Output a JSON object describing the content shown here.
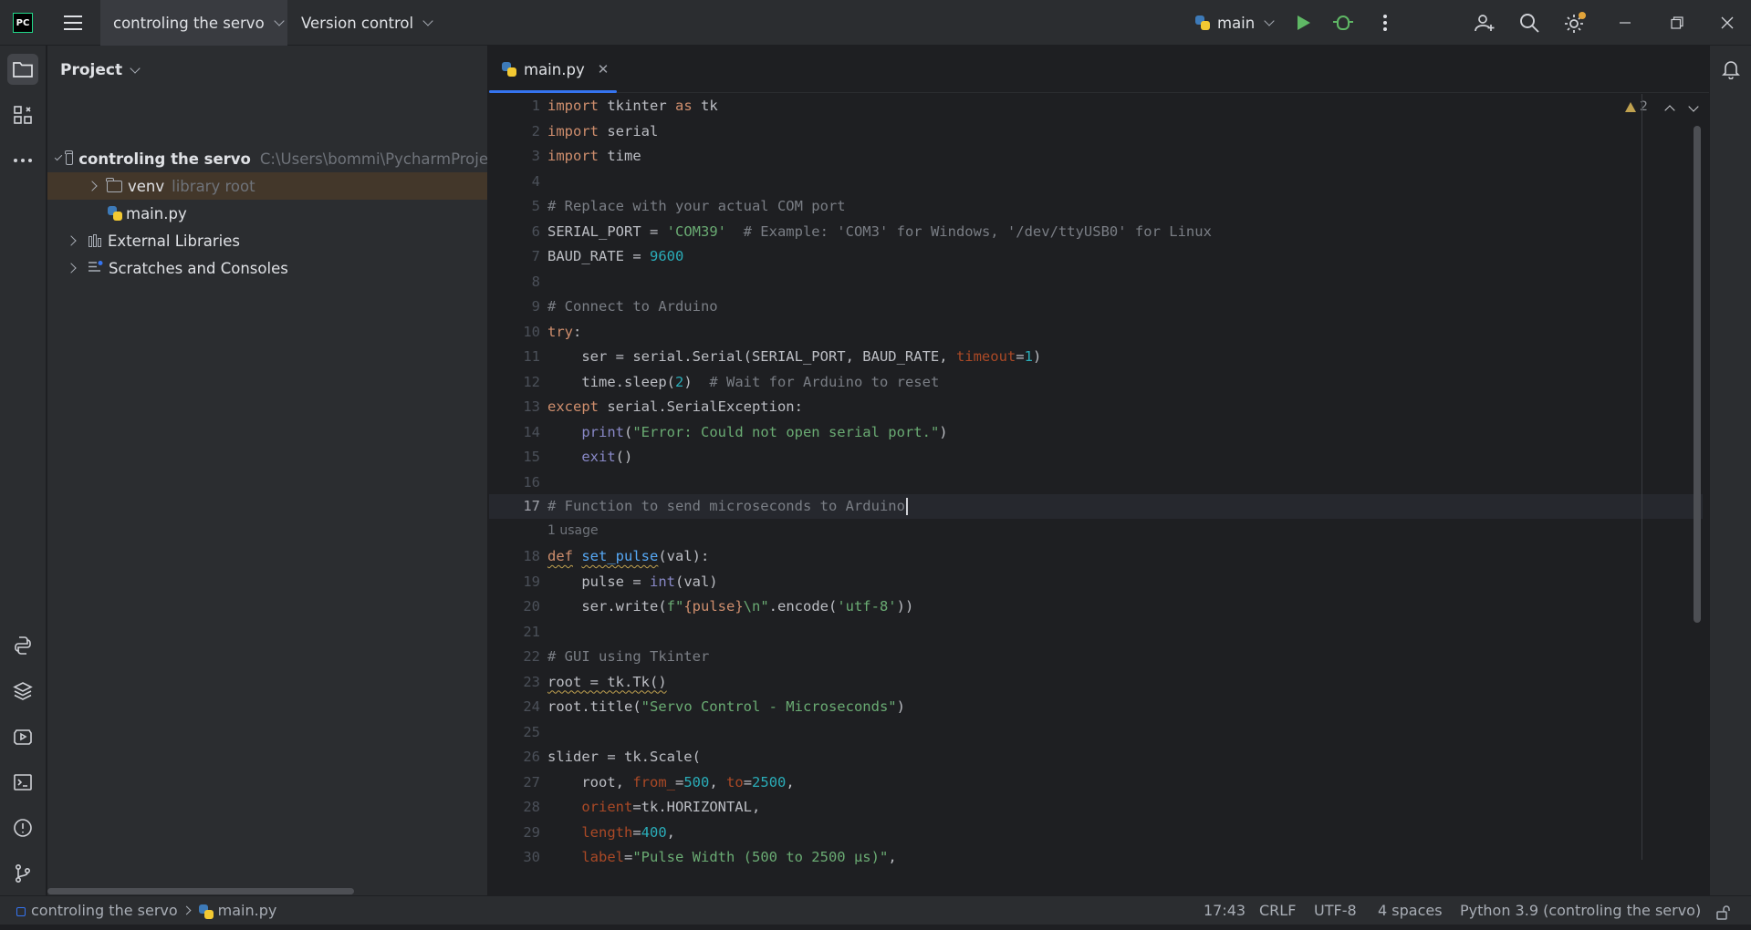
{
  "titlebar": {
    "logo_text": "PC",
    "project_name": "controling the servo",
    "version_control": "Version control",
    "run_config": "main"
  },
  "project_panel": {
    "title": "Project",
    "tree": {
      "root_name": "controling the servo",
      "root_path": "C:\\Users\\bommi\\PycharmProje",
      "venv_name": "venv",
      "venv_hint": "library root",
      "main_file": "main.py",
      "external_libraries": "External Libraries",
      "scratches": "Scratches and Consoles"
    }
  },
  "editor": {
    "tab_label": "main.py",
    "warning_count": "2",
    "usage_hint": "1 usage",
    "current_line": "17",
    "line_numbers": [
      "1",
      "2",
      "3",
      "4",
      "5",
      "6",
      "7",
      "8",
      "9",
      "10",
      "11",
      "12",
      "13",
      "14",
      "15",
      "16",
      "17",
      "18",
      "19",
      "20",
      "21",
      "22",
      "23",
      "24",
      "25",
      "26",
      "27",
      "28",
      "29",
      "30"
    ],
    "code": {
      "l1": [
        "import",
        " tkinter ",
        "as",
        " tk"
      ],
      "l2": [
        "import",
        " serial"
      ],
      "l3": [
        "import",
        " time"
      ],
      "l5": "# Replace with your actual COM port",
      "l6": [
        "SERIAL_PORT = ",
        "'COM39'",
        "  # Example: 'COM3' for Windows, '/dev/ttyUSB0' for Linux"
      ],
      "l7": [
        "BAUD_RATE = ",
        "9600"
      ],
      "l9": "# Connect to Arduino",
      "l10": [
        "try",
        ":"
      ],
      "l11": [
        "    ser = serial.Serial(SERIAL_PORT, BAUD_RATE, ",
        "timeout",
        "=",
        "1",
        ")"
      ],
      "l12": [
        "    time.sleep(",
        "2",
        ")  ",
        "# Wait for Arduino to reset"
      ],
      "l13": [
        "except",
        " serial.SerialException:"
      ],
      "l14": [
        "    ",
        "print",
        "(",
        "\"Error: Could not open serial port.\"",
        ")"
      ],
      "l15": [
        "    ",
        "exit",
        "()"
      ],
      "l17": "# Function to send microseconds to Arduino",
      "l18": [
        "def",
        " ",
        "set_pulse",
        "(val):"
      ],
      "l19": [
        "    pulse = ",
        "int",
        "(val)"
      ],
      "l20": [
        "    ser.write(",
        "f\"",
        "{pulse}",
        "\\n\"",
        ".encode(",
        "'utf-8'",
        "))"
      ],
      "l22": "# GUI using Tkinter",
      "l23": [
        "root = tk.Tk()"
      ],
      "l24": [
        "root.title(",
        "\"Servo Control - Microseconds\"",
        ")"
      ],
      "l26": [
        "slider = tk.Scale("
      ],
      "l27": [
        "    root, ",
        "from_",
        "=",
        "500",
        ", ",
        "to",
        "=",
        "2500",
        ","
      ],
      "l28": [
        "    ",
        "orient",
        "=tk.HORIZONTAL,"
      ],
      "l29": [
        "    ",
        "length",
        "=",
        "400",
        ","
      ],
      "l30": [
        "    ",
        "label",
        "=",
        "\"Pulse Width (500 to 2500 µs)\"",
        ","
      ]
    }
  },
  "statusbar": {
    "project": "controling the servo",
    "file": "main.py",
    "position": "17:43",
    "line_ending": "CRLF",
    "encoding": "UTF-8",
    "indent": "4 spaces",
    "interpreter": "Python 3.9 (controling the servo)"
  },
  "colors": {
    "accent": "#3574f0",
    "keyword": "#cf8e6d",
    "string": "#6aab73",
    "number": "#2aacb8",
    "comment": "#7a7e85",
    "run_green": "#5fb865"
  }
}
